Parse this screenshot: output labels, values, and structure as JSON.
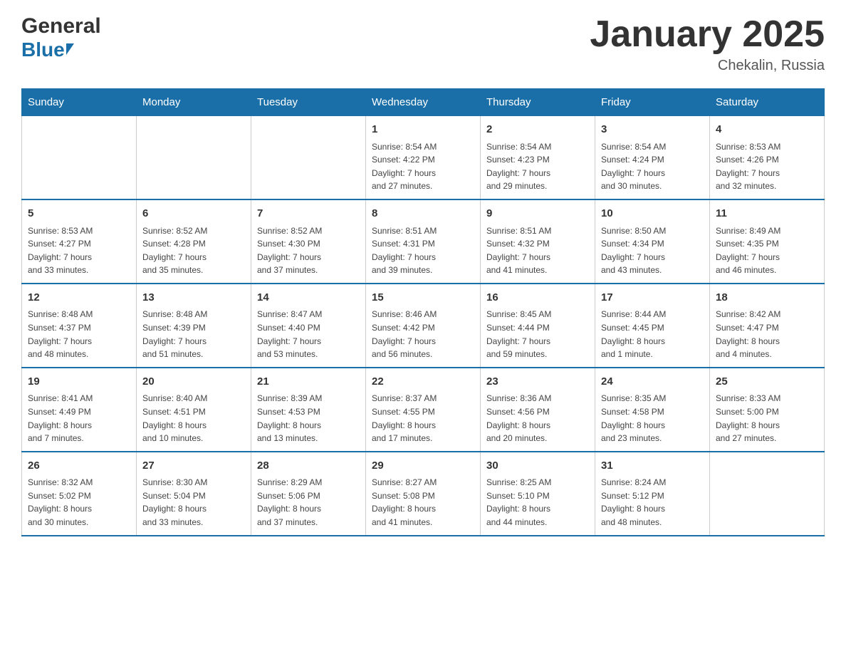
{
  "header": {
    "logo_general": "General",
    "logo_blue": "Blue",
    "title": "January 2025",
    "subtitle": "Chekalin, Russia"
  },
  "calendar": {
    "days_of_week": [
      "Sunday",
      "Monday",
      "Tuesday",
      "Wednesday",
      "Thursday",
      "Friday",
      "Saturday"
    ],
    "weeks": [
      [
        {
          "day": "",
          "info": ""
        },
        {
          "day": "",
          "info": ""
        },
        {
          "day": "",
          "info": ""
        },
        {
          "day": "1",
          "info": "Sunrise: 8:54 AM\nSunset: 4:22 PM\nDaylight: 7 hours\nand 27 minutes."
        },
        {
          "day": "2",
          "info": "Sunrise: 8:54 AM\nSunset: 4:23 PM\nDaylight: 7 hours\nand 29 minutes."
        },
        {
          "day": "3",
          "info": "Sunrise: 8:54 AM\nSunset: 4:24 PM\nDaylight: 7 hours\nand 30 minutes."
        },
        {
          "day": "4",
          "info": "Sunrise: 8:53 AM\nSunset: 4:26 PM\nDaylight: 7 hours\nand 32 minutes."
        }
      ],
      [
        {
          "day": "5",
          "info": "Sunrise: 8:53 AM\nSunset: 4:27 PM\nDaylight: 7 hours\nand 33 minutes."
        },
        {
          "day": "6",
          "info": "Sunrise: 8:52 AM\nSunset: 4:28 PM\nDaylight: 7 hours\nand 35 minutes."
        },
        {
          "day": "7",
          "info": "Sunrise: 8:52 AM\nSunset: 4:30 PM\nDaylight: 7 hours\nand 37 minutes."
        },
        {
          "day": "8",
          "info": "Sunrise: 8:51 AM\nSunset: 4:31 PM\nDaylight: 7 hours\nand 39 minutes."
        },
        {
          "day": "9",
          "info": "Sunrise: 8:51 AM\nSunset: 4:32 PM\nDaylight: 7 hours\nand 41 minutes."
        },
        {
          "day": "10",
          "info": "Sunrise: 8:50 AM\nSunset: 4:34 PM\nDaylight: 7 hours\nand 43 minutes."
        },
        {
          "day": "11",
          "info": "Sunrise: 8:49 AM\nSunset: 4:35 PM\nDaylight: 7 hours\nand 46 minutes."
        }
      ],
      [
        {
          "day": "12",
          "info": "Sunrise: 8:48 AM\nSunset: 4:37 PM\nDaylight: 7 hours\nand 48 minutes."
        },
        {
          "day": "13",
          "info": "Sunrise: 8:48 AM\nSunset: 4:39 PM\nDaylight: 7 hours\nand 51 minutes."
        },
        {
          "day": "14",
          "info": "Sunrise: 8:47 AM\nSunset: 4:40 PM\nDaylight: 7 hours\nand 53 minutes."
        },
        {
          "day": "15",
          "info": "Sunrise: 8:46 AM\nSunset: 4:42 PM\nDaylight: 7 hours\nand 56 minutes."
        },
        {
          "day": "16",
          "info": "Sunrise: 8:45 AM\nSunset: 4:44 PM\nDaylight: 7 hours\nand 59 minutes."
        },
        {
          "day": "17",
          "info": "Sunrise: 8:44 AM\nSunset: 4:45 PM\nDaylight: 8 hours\nand 1 minute."
        },
        {
          "day": "18",
          "info": "Sunrise: 8:42 AM\nSunset: 4:47 PM\nDaylight: 8 hours\nand 4 minutes."
        }
      ],
      [
        {
          "day": "19",
          "info": "Sunrise: 8:41 AM\nSunset: 4:49 PM\nDaylight: 8 hours\nand 7 minutes."
        },
        {
          "day": "20",
          "info": "Sunrise: 8:40 AM\nSunset: 4:51 PM\nDaylight: 8 hours\nand 10 minutes."
        },
        {
          "day": "21",
          "info": "Sunrise: 8:39 AM\nSunset: 4:53 PM\nDaylight: 8 hours\nand 13 minutes."
        },
        {
          "day": "22",
          "info": "Sunrise: 8:37 AM\nSunset: 4:55 PM\nDaylight: 8 hours\nand 17 minutes."
        },
        {
          "day": "23",
          "info": "Sunrise: 8:36 AM\nSunset: 4:56 PM\nDaylight: 8 hours\nand 20 minutes."
        },
        {
          "day": "24",
          "info": "Sunrise: 8:35 AM\nSunset: 4:58 PM\nDaylight: 8 hours\nand 23 minutes."
        },
        {
          "day": "25",
          "info": "Sunrise: 8:33 AM\nSunset: 5:00 PM\nDaylight: 8 hours\nand 27 minutes."
        }
      ],
      [
        {
          "day": "26",
          "info": "Sunrise: 8:32 AM\nSunset: 5:02 PM\nDaylight: 8 hours\nand 30 minutes."
        },
        {
          "day": "27",
          "info": "Sunrise: 8:30 AM\nSunset: 5:04 PM\nDaylight: 8 hours\nand 33 minutes."
        },
        {
          "day": "28",
          "info": "Sunrise: 8:29 AM\nSunset: 5:06 PM\nDaylight: 8 hours\nand 37 minutes."
        },
        {
          "day": "29",
          "info": "Sunrise: 8:27 AM\nSunset: 5:08 PM\nDaylight: 8 hours\nand 41 minutes."
        },
        {
          "day": "30",
          "info": "Sunrise: 8:25 AM\nSunset: 5:10 PM\nDaylight: 8 hours\nand 44 minutes."
        },
        {
          "day": "31",
          "info": "Sunrise: 8:24 AM\nSunset: 5:12 PM\nDaylight: 8 hours\nand 48 minutes."
        },
        {
          "day": "",
          "info": ""
        }
      ]
    ]
  }
}
